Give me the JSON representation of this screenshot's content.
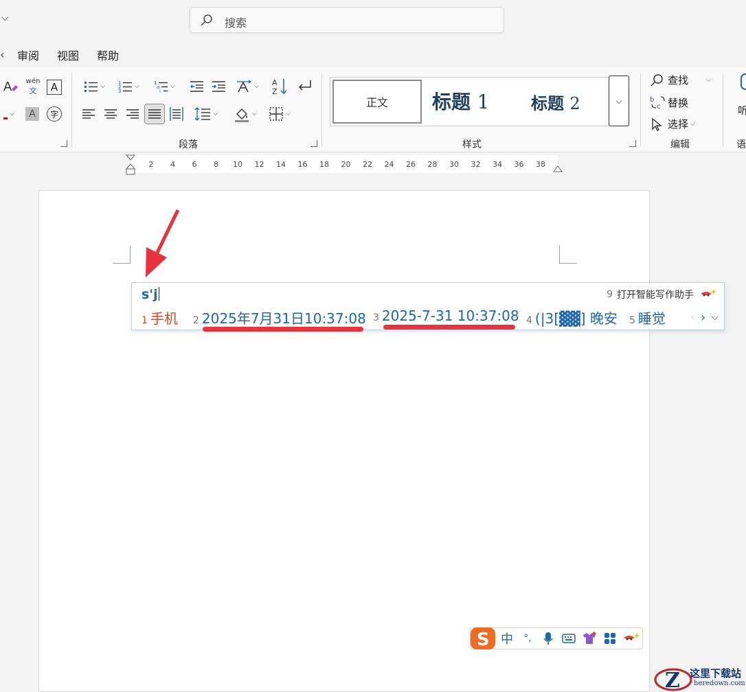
{
  "search": {
    "placeholder": "搜索"
  },
  "menu": {
    "items": [
      "审阅",
      "视图",
      "帮助"
    ]
  },
  "ribbon": {
    "groups": {
      "paragraph": "段落",
      "styles": "样式",
      "editing": "编辑",
      "next_partial": "语"
    },
    "font_icons": {
      "pinyin_top": "wén",
      "pinyin_bottom": "文",
      "char_border": "A",
      "char_shading": "A",
      "enclose": "字"
    },
    "styles": {
      "normal": "正文",
      "heading1_text": "标题",
      "heading1_num": "1",
      "heading2_text": "标题",
      "heading2_num": "2"
    },
    "editing": {
      "find": "查找",
      "replace": "替换",
      "select": "选择"
    },
    "listen_partial": "听"
  },
  "ruler": {
    "ticks": [
      "2",
      "4",
      "6",
      "8",
      "10",
      "12",
      "14",
      "16",
      "18",
      "20",
      "22",
      "24",
      "26",
      "28",
      "30",
      "32",
      "34",
      "36",
      "38"
    ]
  },
  "ime": {
    "input": "s'j",
    "assist_num": "9",
    "assist_label": "打开智能写作助手",
    "candidates": [
      {
        "num": "1",
        "text": "手机"
      },
      {
        "num": "2",
        "text": "2025年7月31日10:37:08"
      },
      {
        "num": "3",
        "text": "2025-7-31 10:37:08"
      },
      {
        "num": "4",
        "text": "(|3[▓▓] 晚安"
      },
      {
        "num": "5",
        "text": "睡觉"
      }
    ],
    "toolbar": {
      "mode": "中",
      "punct": "°,"
    }
  },
  "watermark": {
    "cn": "这里下载站",
    "en": "heredown.com"
  },
  "colors": {
    "accent": "#1a66b0",
    "annotation": "#e8323c",
    "first_candidate": "#e2461f"
  }
}
